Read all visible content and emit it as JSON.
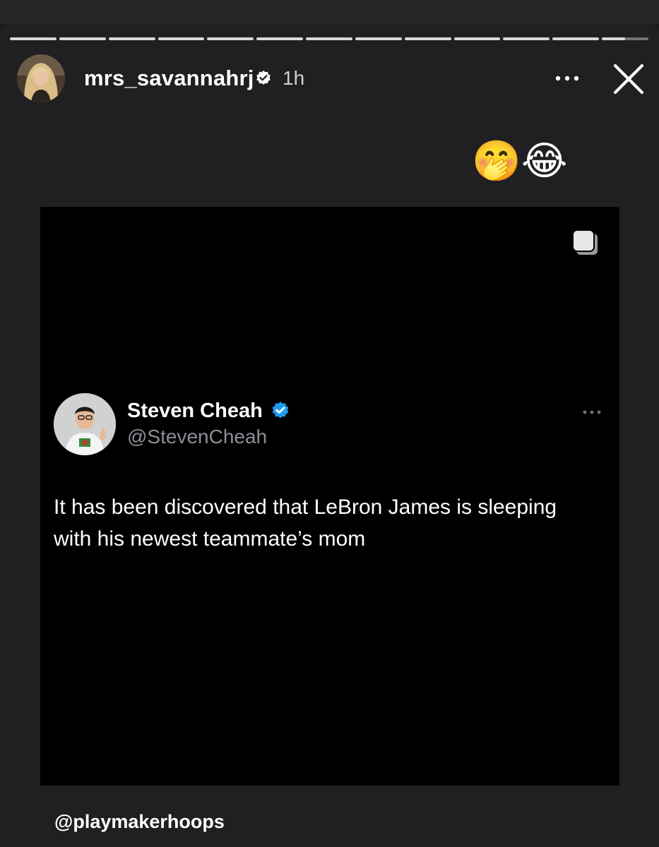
{
  "story": {
    "progress_segments": [
      1,
      1,
      1,
      1,
      1,
      1,
      1,
      1,
      1,
      1,
      1,
      1,
      0.5
    ],
    "author": {
      "username": "mrs_savannahrj",
      "verified": true,
      "time_ago": "1h",
      "avatar_icon": "profile-photo"
    },
    "controls": {
      "more_icon": "more-options-icon",
      "close_icon": "close-icon"
    },
    "stickers": [
      "🤭",
      "😂"
    ],
    "mention": "@playmakerhoops"
  },
  "shared_post": {
    "carousel_icon": "carousel-icon",
    "tweet": {
      "display_name": "Steven Cheah",
      "handle": "@StevenCheah",
      "verified": true,
      "text": "It has been discovered that LeBron James is sleeping with his newest teammate’s mom"
    }
  },
  "colors": {
    "background": "#202022",
    "card": "#000000",
    "verified_blue": "#1d9bf0",
    "handle_gray": "#8b9096"
  }
}
